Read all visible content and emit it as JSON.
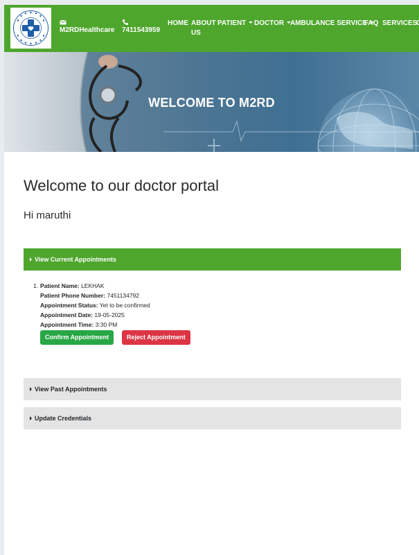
{
  "navbar": {
    "logo": {
      "ring_text": "HEALTHCARE"
    },
    "email_label": "M2RDHealthcare",
    "phone_label": "7411543959",
    "items": [
      {
        "label": "HOME",
        "dropdown": false
      },
      {
        "label": "ABOUT",
        "line2": "US",
        "dropdown": false
      },
      {
        "label": "PATIENT",
        "dropdown": true
      },
      {
        "label": "DOCTOR",
        "dropdown": true
      },
      {
        "label": "AMBULANCE SERVICE",
        "dropdown": true
      },
      {
        "label": "FAQ",
        "dropdown": false
      },
      {
        "label": "SERVICES",
        "dropdown": false
      },
      {
        "label": "G",
        "dropdown": false
      }
    ]
  },
  "hero": {
    "title": "WELCOME TO M2RD"
  },
  "portal": {
    "title": "Welcome to our doctor portal",
    "greeting": "Hi maruthi"
  },
  "accordion": {
    "current_label": "View Current Appointments",
    "past_label": "View Past Appointments",
    "credentials_label": "Update Credentials"
  },
  "appointment": {
    "number": "1.",
    "patient_name_label": "Patient Name:",
    "patient_name": "LEKHAK",
    "phone_label": "Patient Phone Number:",
    "phone": "7451134792",
    "status_label": "Appointment Status:",
    "status": "Yet to be confirmed",
    "date_label": "Appointment Date:",
    "date": "19-05-2025",
    "time_label": "Appointment Time:",
    "time": "3:30 PM",
    "confirm_label": "Confirm Appointment",
    "reject_label": "Reject Appointment"
  },
  "colors": {
    "brand_green": "#4ea62d",
    "confirm_green": "#28a745",
    "reject_red": "#dc3545",
    "logo_blue": "#1f5ea8"
  }
}
